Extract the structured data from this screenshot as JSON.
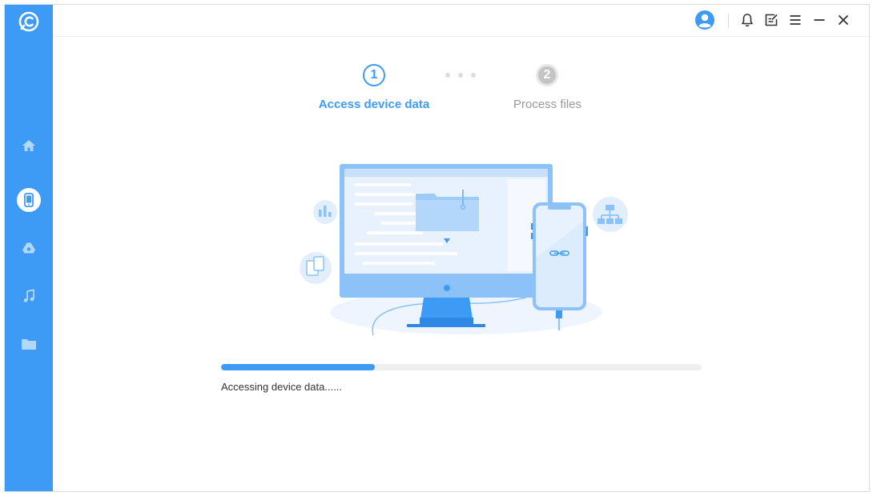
{
  "sidebar": {
    "items": [
      {
        "icon": "home-icon"
      },
      {
        "icon": "phone-icon",
        "active": true
      },
      {
        "icon": "cloud-drive-icon"
      },
      {
        "icon": "music-note-icon"
      },
      {
        "icon": "folder-icon"
      }
    ]
  },
  "titlebar": {
    "icons": [
      "user-avatar-icon",
      "bell-icon",
      "feedback-icon",
      "menu-icon",
      "minimize-icon",
      "close-icon"
    ]
  },
  "steps": [
    {
      "number": "1",
      "label": "Access device data",
      "state": "active"
    },
    {
      "number": "2",
      "label": "Process files",
      "state": "inactive"
    }
  ],
  "progress": {
    "percent": 32,
    "text": "Accessing device data......"
  },
  "colors": {
    "accent": "#3d9bf5",
    "inactive": "#c4c4c4",
    "track": "#eeeff1"
  }
}
